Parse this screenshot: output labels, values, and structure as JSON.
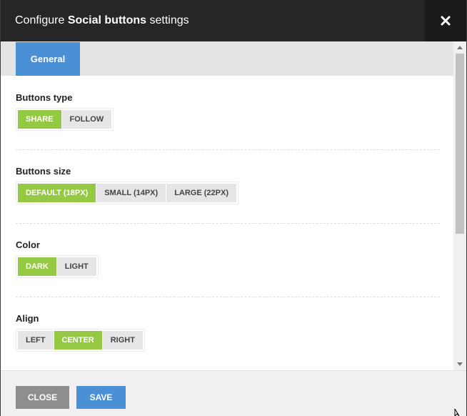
{
  "dialog": {
    "title_prefix": "Configure ",
    "title_bold": "Social buttons",
    "title_suffix": " settings",
    "close_icon": "close-icon"
  },
  "tabs": [
    {
      "label": "General",
      "active": true
    }
  ],
  "sections": {
    "buttons_type": {
      "label": "Buttons type",
      "options": [
        "SHARE",
        "FOLLOW"
      ],
      "selected": "SHARE"
    },
    "buttons_size": {
      "label": "Buttons size",
      "options": [
        "DEFAULT (18PX)",
        "SMALL (14PX)",
        "LARGE (22PX)"
      ],
      "selected": "DEFAULT (18PX)"
    },
    "color": {
      "label": "Color",
      "options": [
        "DARK",
        "LIGHT"
      ],
      "selected": "DARK"
    },
    "align": {
      "label": "Align",
      "options": [
        "LEFT",
        "CENTER",
        "RIGHT"
      ],
      "selected": "CENTER"
    }
  },
  "footer": {
    "close_label": "CLOSE",
    "save_label": "SAVE"
  },
  "colors": {
    "active_option": "#95c943",
    "primary": "#4a90d6",
    "header": "#262626",
    "secondary_button": "#8e8e8e"
  }
}
